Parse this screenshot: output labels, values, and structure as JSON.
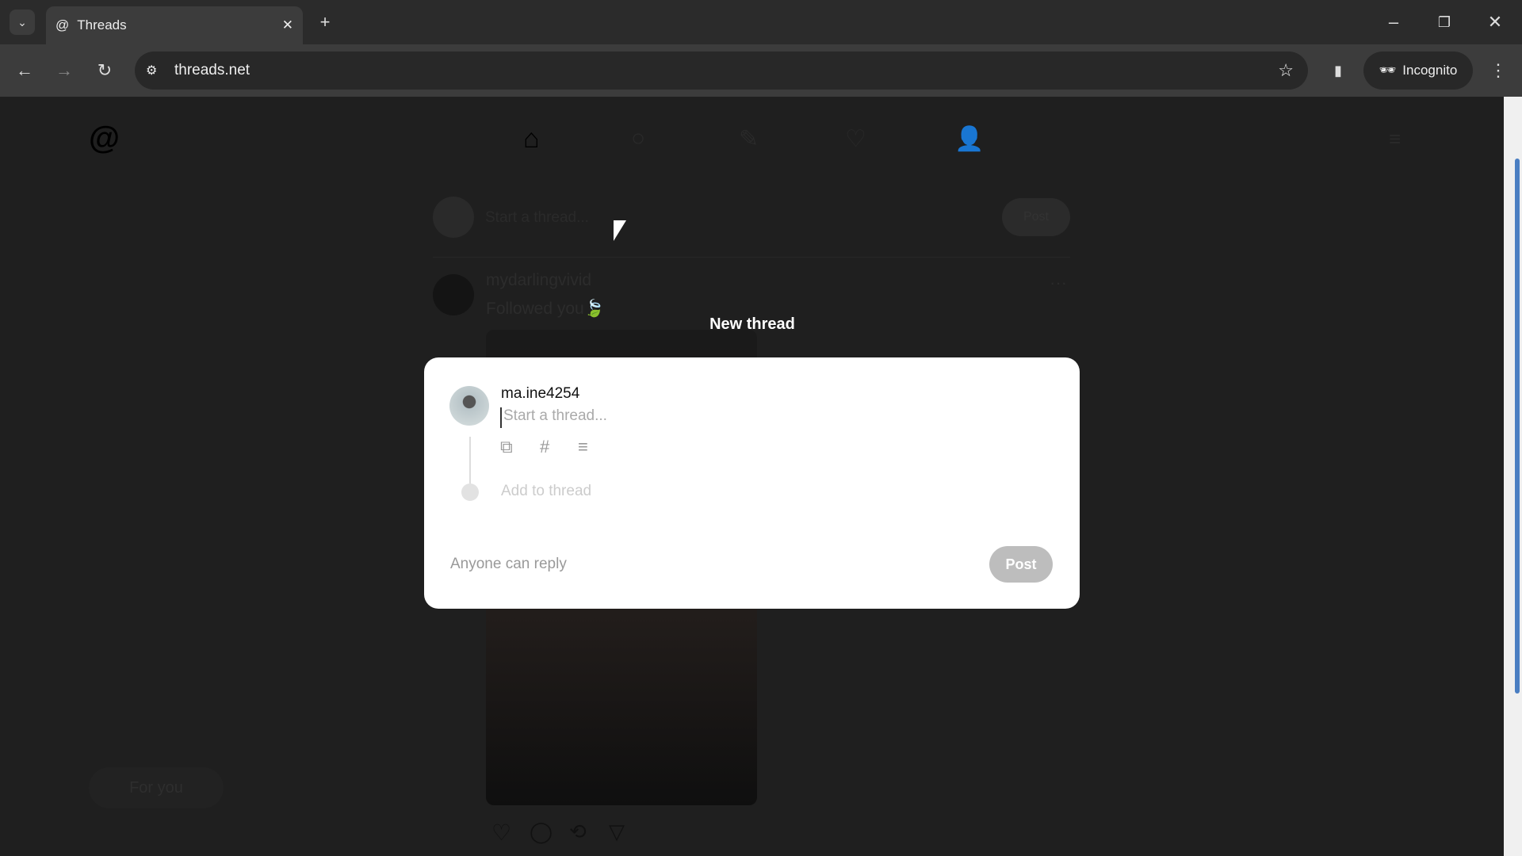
{
  "browser": {
    "tab_title": "Threads",
    "url": "threads.net",
    "incognito_label": "Incognito"
  },
  "feed": {
    "composer_placeholder": "Start a thread...",
    "composer_post": "Post",
    "post": {
      "username": "mydarlingvivid",
      "text": "Followed you🍃"
    },
    "feed_switch": "For you"
  },
  "modal": {
    "title": "New thread",
    "username": "ma.ine4254",
    "placeholder": "Start a thread...",
    "add_to_thread": "Add to thread",
    "reply_setting": "Anyone can reply",
    "post_label": "Post"
  }
}
